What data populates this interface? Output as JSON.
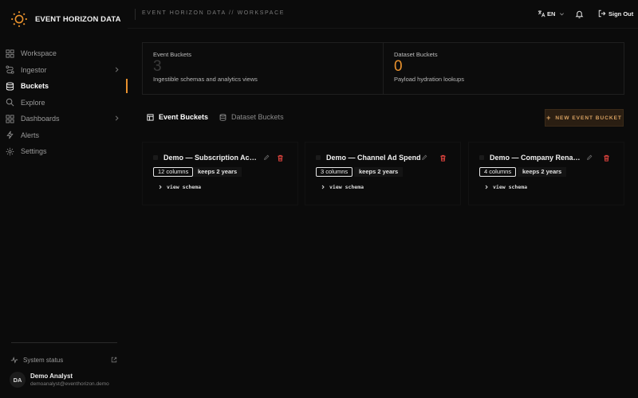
{
  "app": {
    "brand_name": "EVENT HORIZON DATA",
    "accent_color": "#e8912d"
  },
  "sidebar": {
    "items": [
      {
        "label": "Workspace",
        "icon": "grid-icon"
      },
      {
        "label": "Ingestor",
        "icon": "route-icon",
        "expandable": true
      },
      {
        "label": "Buckets",
        "icon": "database-icon",
        "active": true
      },
      {
        "label": "Explore",
        "icon": "search-icon"
      },
      {
        "label": "Dashboards",
        "icon": "layout-icon",
        "expandable": true
      },
      {
        "label": "Alerts",
        "icon": "lightning-icon"
      },
      {
        "label": "Settings",
        "icon": "gear-icon"
      }
    ],
    "system_status": "System status",
    "user": {
      "initials": "DA",
      "name": "Demo Analyst",
      "email": "demoanalyst@eventhorizon.demo"
    }
  },
  "topbar": {
    "breadcrumb": "EVENT HORIZON DATA // WORKSPACE",
    "language": "EN",
    "sign_out": "Sign Out"
  },
  "stats": [
    {
      "label": "Event Buckets",
      "value": "3",
      "description": "Ingestible schemas and analytics views"
    },
    {
      "label": "Dataset Buckets",
      "value": "0",
      "description": "Payload hydration lookups"
    }
  ],
  "tabs": [
    {
      "label": "Event Buckets",
      "active": true
    },
    {
      "label": "Dataset Buckets",
      "active": false
    }
  ],
  "new_button": "NEW EVENT BUCKET",
  "buckets": [
    {
      "title": "Demo — Subscription Acti…",
      "columns": "12 columns",
      "retention": "keeps 2 years",
      "schema_link": "view schema"
    },
    {
      "title": "Demo — Channel Ad Spend",
      "columns": "3 columns",
      "retention": "keeps 2 years",
      "schema_link": "view schema"
    },
    {
      "title": "Demo — Company Renames",
      "columns": "4 columns",
      "retention": "keeps 2 years",
      "schema_link": "view schema"
    }
  ]
}
